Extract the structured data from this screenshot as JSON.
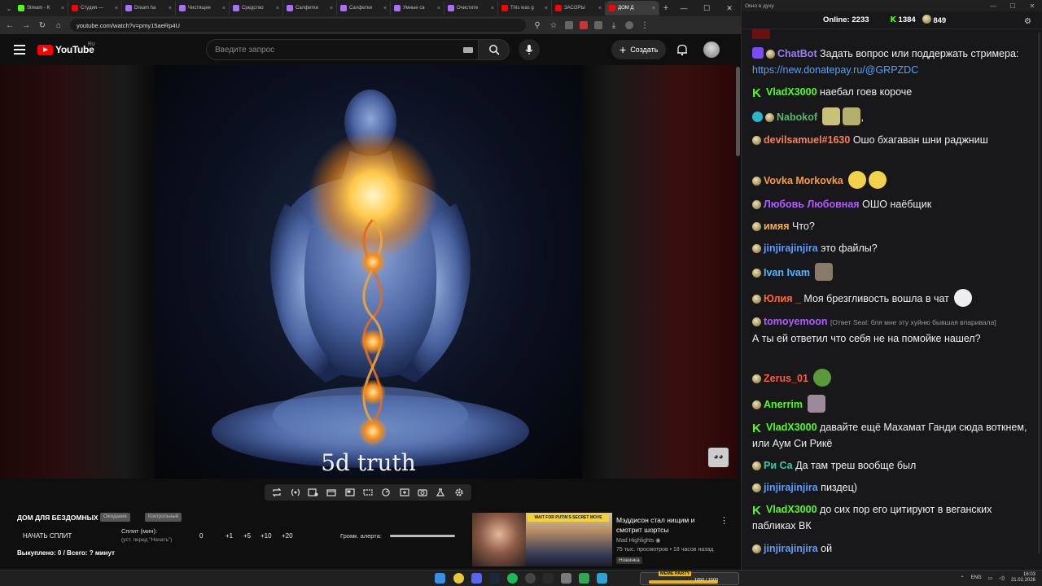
{
  "browser": {
    "tabs": [
      {
        "label": "Stream - K",
        "color": "#53fc18"
      },
      {
        "label": "Студия —",
        "color": "#ff0000"
      },
      {
        "label": "Dream ha",
        "color": "#a970ff"
      },
      {
        "label": "Чистящее",
        "color": "#a970ff"
      },
      {
        "label": "Средство",
        "color": "#a970ff"
      },
      {
        "label": "Салфетки",
        "color": "#a970ff"
      },
      {
        "label": "Салфетки",
        "color": "#a970ff"
      },
      {
        "label": "Умные са",
        "color": "#a970ff"
      },
      {
        "label": "Очистите",
        "color": "#a970ff"
      },
      {
        "label": "This was g",
        "color": "#ff0000"
      },
      {
        "label": "ЗАСОРЫ",
        "color": "#ff0000"
      },
      {
        "label": "ДОМ Д",
        "color": "#ff0000"
      }
    ],
    "url": "youtube.com/watch?v=pmy15aeRp4U"
  },
  "youtube": {
    "logo_text": "YouTube",
    "region": "RU",
    "search_placeholder": "Введите запрос",
    "create_label": "Создать"
  },
  "video": {
    "caption": "5d truth"
  },
  "panel": {
    "title": "ДОМ ДЛЯ БЕЗДОМНЫХ",
    "chip1": "Ожидание",
    "chip2": "Контрольный",
    "start_button": "НАЧАТЬ СПЛИТ",
    "split_label": "Сплит (мин):",
    "split_hint": "(уст. перед \"Начать\")",
    "num_buttons": [
      "0",
      "+1",
      "+5",
      "+10",
      "+20"
    ],
    "alert_label": "Громк. алерта:",
    "done_text": "Выкуплено: 0 / Всего: ? минут"
  },
  "recommendation": {
    "banner": "WAIT FOR PUTIN'S SECRET MOVE",
    "title": "Мэддисон стал нищим и смотрит шортсы",
    "channel": "Mad Highlights",
    "meta": "75 тыс. просмотров • 18 часов назад",
    "badge": "Новинка"
  },
  "chat": {
    "window_title": "Окно в духу",
    "online_label": "Online:",
    "online_count": "2233",
    "kick_count": "1384",
    "pawn_count": "849",
    "messages": [
      {
        "user": "ChatBot",
        "color": "#9b7cff",
        "text": "Задать вопрос или поддержать стримера: ",
        "link": "https://new.donatepay.ru/@GRPZDC"
      },
      {
        "user": "VladX3000",
        "color": "#53fc18",
        "text": "наебал гоев короче"
      },
      {
        "user": "Nabokof",
        "color": "#53b96b",
        "text": ""
      },
      {
        "user": "devilsamuel#1630",
        "color": "#ff7f50",
        "text": "Ошо бхагаван шни раджниш"
      },
      {
        "user": "Vovka Morkovka",
        "color": "#ff9a2e",
        "text": ""
      },
      {
        "user": "Любовь Любовная",
        "color": "#b05cff",
        "text": "ОШО наёбщик"
      },
      {
        "user": "имяя",
        "color": "#ffb02e",
        "text": "Что?"
      },
      {
        "user": "jinjirajinjira",
        "color": "#5c9cff",
        "text": "это файлы?"
      },
      {
        "user": "Ivan Ivam",
        "color": "#4db8ff",
        "text": ""
      },
      {
        "user": "Юлия _",
        "color": "#ff6a3d",
        "text": "Моя брезгливость вошла в чат"
      },
      {
        "user": "tomoyemoon",
        "color": "#b05cff",
        "reply": "[Ответ Seal: бля мне эту хуйню бывшая впаривала]",
        "text": "А ты ей ответил что себя не на помойке нашел?"
      },
      {
        "user": "Zerus_01",
        "color": "#ff5a3d",
        "text": ""
      },
      {
        "user": "Anerrim",
        "color": "#53fc18",
        "text": ""
      },
      {
        "user": "VladX3000",
        "color": "#53fc18",
        "text": "давайте ещё Махамат Ганди сюда воткнем, или Аум Си Рикё"
      },
      {
        "user": "Ри Са",
        "color": "#2ecfa8",
        "text": "Да там треш вообще был"
      },
      {
        "user": "jinjirajinjira",
        "color": "#5c9cff",
        "text": "пиздец)"
      },
      {
        "user": "VladX3000",
        "color": "#53fc18",
        "text": "до сих пор его цитируют в веганских пабликах ВК"
      },
      {
        "user": "jinjirajinjira",
        "color": "#5c9cff",
        "text": "ой"
      }
    ]
  },
  "taskbar": {
    "meme_title": "MEME PARTY",
    "meme_count": "1050 / 1500",
    "lang": "ENG",
    "time": "16:03",
    "date": "21.02.2026"
  }
}
